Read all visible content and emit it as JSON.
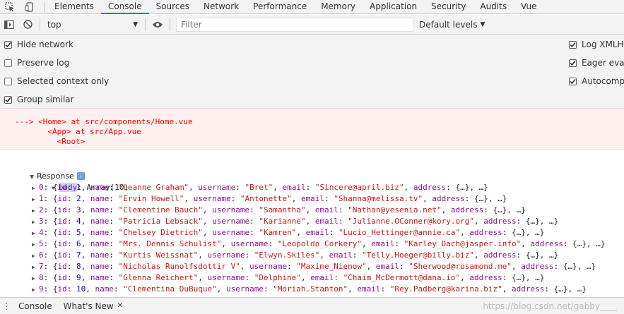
{
  "tabs": [
    {
      "label": "Elements",
      "active": false
    },
    {
      "label": "Console",
      "active": true
    },
    {
      "label": "Sources",
      "active": false
    },
    {
      "label": "Network",
      "active": false
    },
    {
      "label": "Performance",
      "active": false
    },
    {
      "label": "Memory",
      "active": false
    },
    {
      "label": "Application",
      "active": false
    },
    {
      "label": "Security",
      "active": false
    },
    {
      "label": "Audits",
      "active": false
    },
    {
      "label": "Vue",
      "active": false
    }
  ],
  "toolbar": {
    "context_value": "top",
    "filter_placeholder": "Filter",
    "levels_label": "Default levels"
  },
  "settings": {
    "left": [
      {
        "label": "Hide network",
        "checked": true
      },
      {
        "label": "Preserve log",
        "checked": false
      },
      {
        "label": "Selected context only",
        "checked": false
      },
      {
        "label": "Group similar",
        "checked": true
      }
    ],
    "right": [
      {
        "label": "Log XMLHt",
        "checked": true
      },
      {
        "label": "Eager evalu",
        "checked": true
      },
      {
        "label": "Autocompl",
        "checked": true
      }
    ]
  },
  "error_trace": [
    "---> <Home> at src/components/Home.vue",
    "       <App> at src/App.vue",
    "         <Root>"
  ],
  "log": {
    "group_label": "Response",
    "info_badge": "i",
    "body_key": "body",
    "body_value": ": Array(10)",
    "rows": [
      {
        "index": "0",
        "id": "1",
        "name": "\"Leanne Graham\"",
        "username": "\"Bret\"",
        "email": "\"Sincere@april.biz\""
      },
      {
        "index": "1",
        "id": "2",
        "name": "\"Ervin Howell\"",
        "username": "\"Antonette\"",
        "email": "\"Shanna@melissa.tv\""
      },
      {
        "index": "2",
        "id": "3",
        "name": "\"Clementine Bauch\"",
        "username": "\"Samantha\"",
        "email": "\"Nathan@yesenia.net\""
      },
      {
        "index": "3",
        "id": "4",
        "name": "\"Patricia Lebsack\"",
        "username": "\"Karianne\"",
        "email": "\"Julianne.OConner@kory.org\""
      },
      {
        "index": "4",
        "id": "5",
        "name": "\"Chelsey Dietrich\"",
        "username": "\"Kamren\"",
        "email": "\"Lucio_Hettinger@annie.ca\""
      },
      {
        "index": "5",
        "id": "6",
        "name": "\"Mrs. Dennis Schulist\"",
        "username": "\"Leopoldo_Corkery\"",
        "email": "\"Karley_Dach@jasper.info\""
      },
      {
        "index": "6",
        "id": "7",
        "name": "\"Kurtis Weissnat\"",
        "username": "\"Elwyn.Skiles\"",
        "email": "\"Telly.Hoeger@billy.biz\""
      },
      {
        "index": "7",
        "id": "8",
        "name": "\"Nicholas Runolfsdottir V\"",
        "username": "\"Maxime_Nienow\"",
        "email": "\"Sherwood@rosamond.me\""
      },
      {
        "index": "8",
        "id": "9",
        "name": "\"Glenna Reichert\"",
        "username": "\"Delphine\"",
        "email": "\"Chaim_McDermott@dana.io\""
      },
      {
        "index": "9",
        "id": "10",
        "name": "\"Clementina DuBuque\"",
        "username": "\"Moriah.Stanton\"",
        "email": "\"Rey.Padberg@karina.biz\""
      }
    ],
    "tokens": {
      "open": ": {",
      "id_key": "id",
      "name_key": "name",
      "username_key": "username",
      "email_key": "email",
      "address_key": "address",
      "colon": ": ",
      "comma": ", ",
      "address_tail": ": {…}, …}"
    }
  },
  "drawer": {
    "tabs": [
      {
        "label": "Console"
      },
      {
        "label": "What's New"
      }
    ],
    "close_glyph": "✕",
    "watermark": "https://blog.csdn.net/gabby____"
  },
  "icons": [
    "inspect-icon",
    "device-toggle-icon",
    "sidebar-toggle-icon",
    "clear-console-icon",
    "dropdown-caret-icon",
    "eye-icon",
    "checkbox-check-icon",
    "expand-triangle-icon",
    "info-icon",
    "close-icon"
  ]
}
